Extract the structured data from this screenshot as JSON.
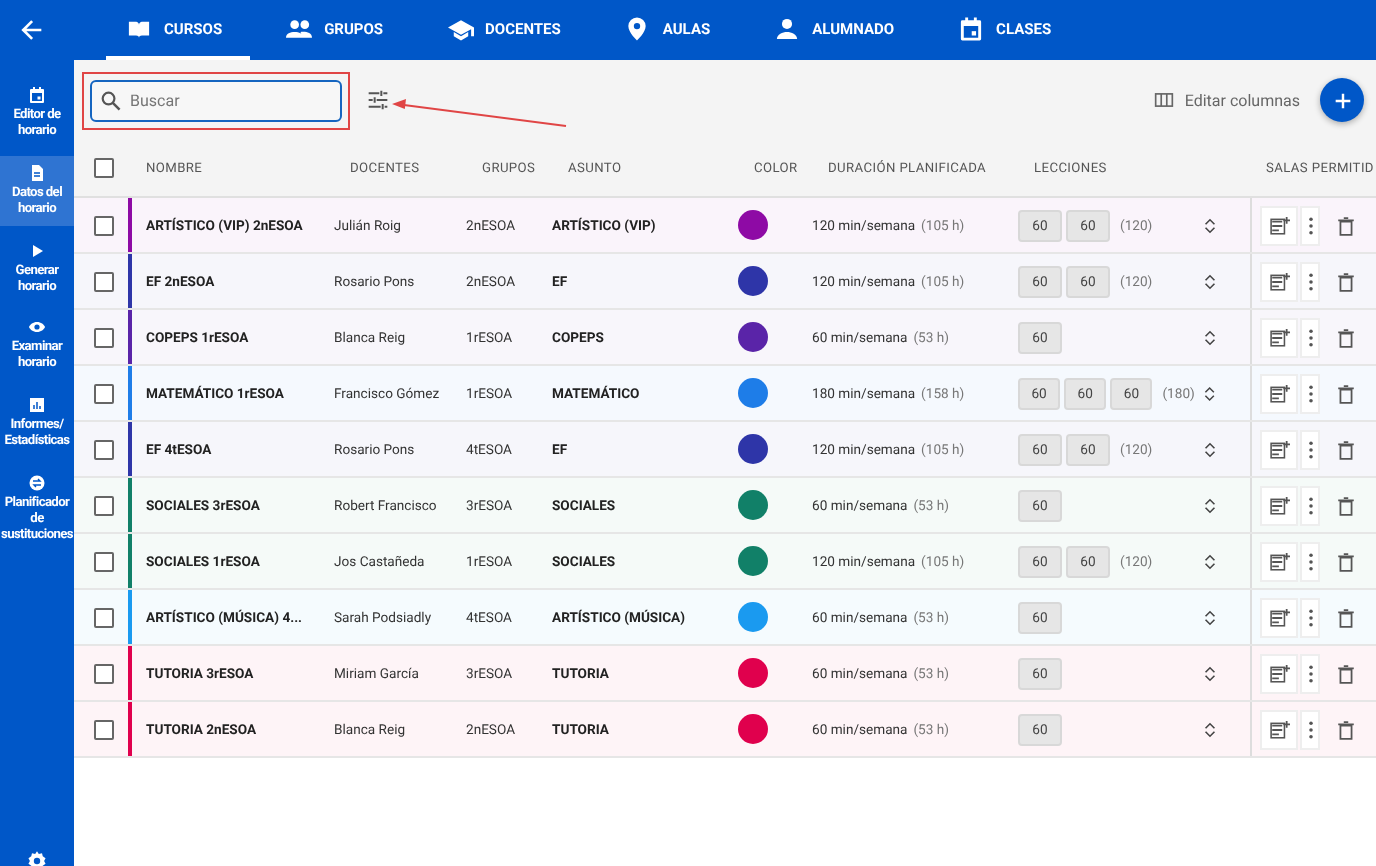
{
  "tabs": [
    {
      "label": "CURSOS",
      "selected": true
    },
    {
      "label": "GRUPOS",
      "selected": false
    },
    {
      "label": "DOCENTES",
      "selected": false
    },
    {
      "label": "AULAS",
      "selected": false
    },
    {
      "label": "ALUMNADO",
      "selected": false
    },
    {
      "label": "CLASES",
      "selected": false
    }
  ],
  "sidebar": {
    "items": [
      {
        "label": "Editor de horario",
        "selected": false
      },
      {
        "label": "Datos del horario",
        "selected": true
      },
      {
        "label": "Generar horario",
        "selected": false
      },
      {
        "label": "Examinar horario",
        "selected": false
      },
      {
        "label": "Informes/ Estadísticas",
        "selected": false
      },
      {
        "label": "Planificador de sustituciones",
        "selected": false
      }
    ]
  },
  "search": {
    "placeholder": "Buscar"
  },
  "edit_columns": "Editar columnas",
  "table": {
    "select_all_checked": false,
    "columns": [
      "NOMBRE",
      "DOCENTES",
      "GRUPOS",
      "ASUNTO",
      "COLOR",
      "DURACIÓN PLANIFICADA",
      "LECCIONES",
      "SALAS PERMITID"
    ],
    "rows": [
      {
        "checked": false,
        "name": "ARTÍSTICO (VIP) 2nESOA",
        "teacher": "Julián Roig",
        "group": "2nESOA",
        "subject": "ARTÍSTICO (VIP)",
        "color": "#8e0aa5",
        "duration": "120 min/semana",
        "hours": "(105 h)",
        "lessons": [
          "60",
          "60"
        ],
        "total": "(120)"
      },
      {
        "checked": false,
        "name": "EF 2nESOA",
        "teacher": "Rosario Pons",
        "group": "2nESOA",
        "subject": "EF",
        "color": "#2e35a8",
        "duration": "120 min/semana",
        "hours": "(105 h)",
        "lessons": [
          "60",
          "60"
        ],
        "total": "(120)"
      },
      {
        "checked": false,
        "name": "COPEPS 1rESOA",
        "teacher": "Blanca Reig",
        "group": "1rESOA",
        "subject": "COPEPS",
        "color": "#5a24a8",
        "duration": "60 min/semana",
        "hours": "(53 h)",
        "lessons": [
          "60"
        ]
      },
      {
        "checked": false,
        "name": "MATEMÁTICO 1rESOA",
        "teacher": "Francisco Gómez",
        "group": "1rESOA",
        "subject": "MATEMÁTICO",
        "color": "#1e7de8",
        "duration": "180 min/semana",
        "hours": "(158 h)",
        "lessons": [
          "60",
          "60",
          "60"
        ],
        "total": "(180)"
      },
      {
        "checked": false,
        "name": "EF 4tESOA",
        "teacher": "Rosario Pons",
        "group": "4tESOA",
        "subject": "EF",
        "color": "#2e35a8",
        "duration": "120 min/semana",
        "hours": "(105 h)",
        "lessons": [
          "60",
          "60"
        ],
        "total": "(120)"
      },
      {
        "checked": false,
        "name": "SOCIALES 3rESOA",
        "teacher": "Robert Francisco",
        "group": "3rESOA",
        "subject": "SOCIALES",
        "color": "#118068",
        "duration": "60 min/semana",
        "hours": "(53 h)",
        "lessons": [
          "60"
        ]
      },
      {
        "checked": false,
        "name": "SOCIALES 1rESOA",
        "teacher": "Jos Castañeda",
        "group": "1rESOA",
        "subject": "SOCIALES",
        "color": "#118068",
        "duration": "120 min/semana",
        "hours": "(105 h)",
        "lessons": [
          "60",
          "60"
        ],
        "total": "(120)"
      },
      {
        "checked": false,
        "name": "ARTÍSTICO (MÚSICA) 4...",
        "teacher": "Sarah Podsiadly",
        "group": "4tESOA",
        "subject": "ARTÍSTICO (MÚSICA)",
        "color": "#1a9af0",
        "duration": "60 min/semana",
        "hours": "(53 h)",
        "lessons": [
          "60"
        ]
      },
      {
        "checked": false,
        "name": "TUTORIA 3rESOA",
        "teacher": "Miriam García",
        "group": "3rESOA",
        "subject": "TUTORIA",
        "color": "#e0004d",
        "duration": "60 min/semana",
        "hours": "(53 h)",
        "lessons": [
          "60"
        ]
      },
      {
        "checked": false,
        "name": "TUTORIA 2nESOA",
        "teacher": "Blanca Reig",
        "group": "2nESOA",
        "subject": "TUTORIA",
        "color": "#e0004d",
        "duration": "60 min/semana",
        "hours": "(53 h)",
        "lessons": [
          "60"
        ]
      }
    ]
  }
}
